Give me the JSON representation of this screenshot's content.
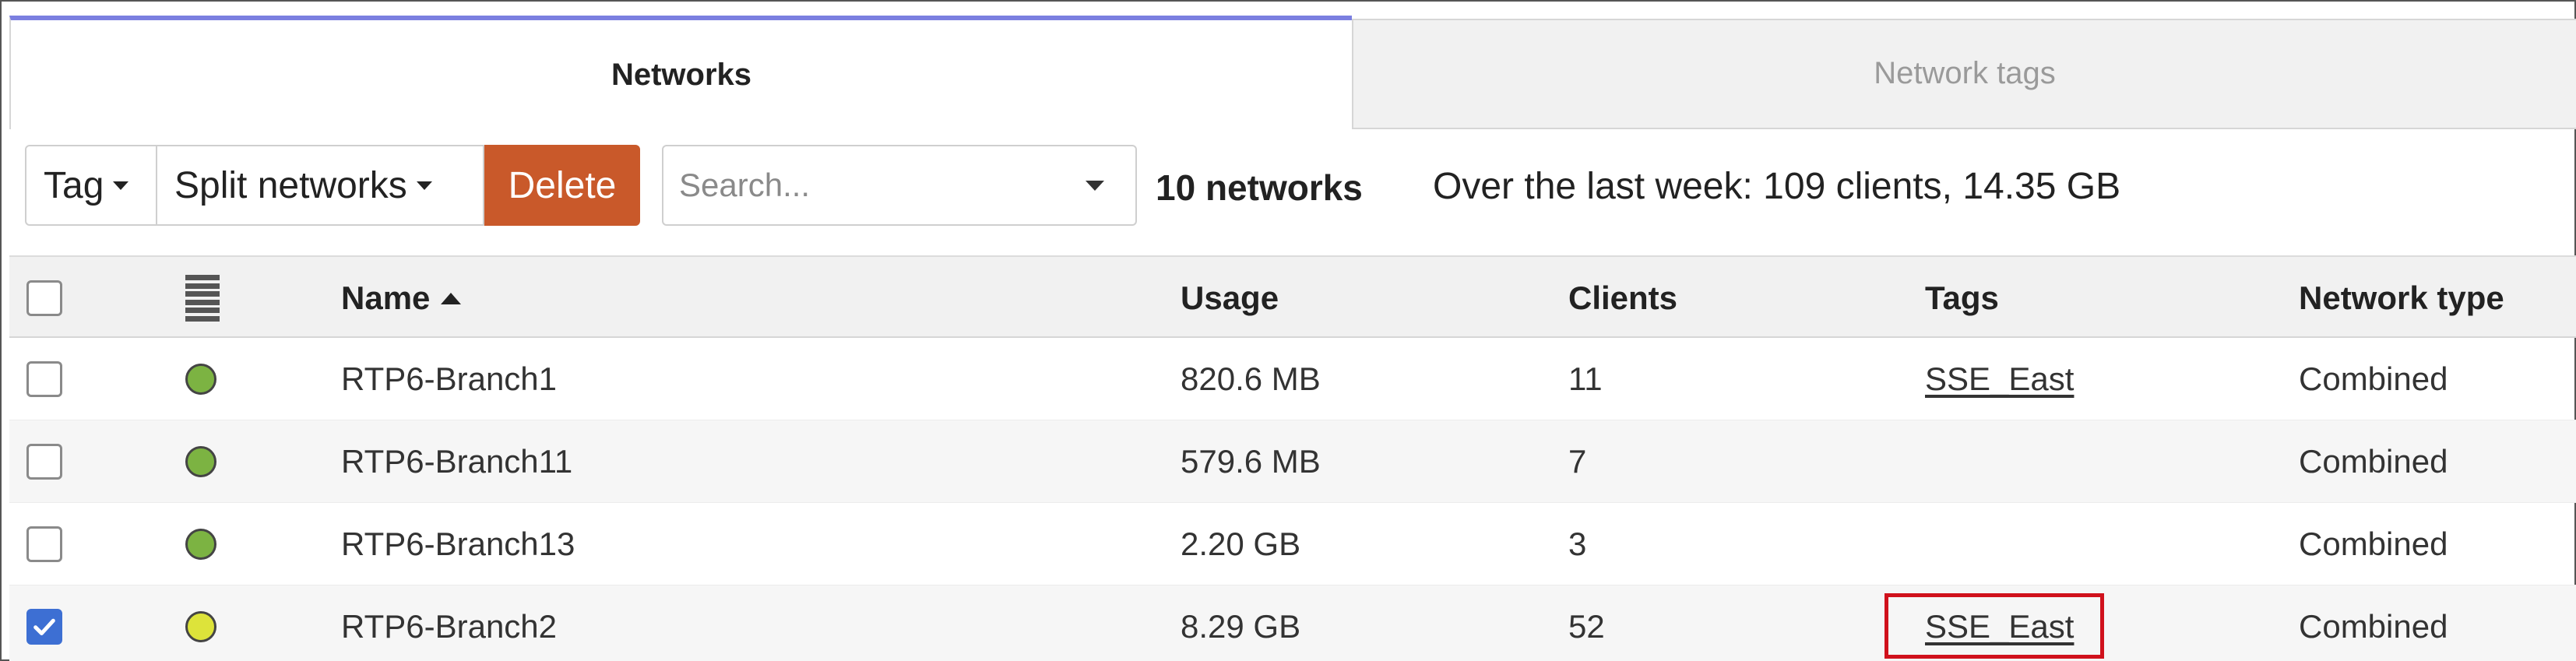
{
  "tabs": {
    "active_label": "Networks",
    "inactive_label": "Network tags"
  },
  "toolbar": {
    "tag_label": "Tag",
    "split_label": "Split networks",
    "delete_label": "Delete",
    "search_placeholder": "Search...",
    "network_count": "10 networks",
    "summary": "Over the last week: 109 clients, 14.35 GB"
  },
  "table": {
    "headers": {
      "name": "Name",
      "usage": "Usage",
      "clients": "Clients",
      "tags": "Tags",
      "type": "Network type"
    },
    "sort": "Name ascending",
    "rows": [
      {
        "name": "RTP6-Branch1",
        "usage": "820.6 MB",
        "clients": "11",
        "tag": "SSE_East",
        "type": "Combined",
        "status_color": "#7cb342",
        "checked": false
      },
      {
        "name": "RTP6-Branch11",
        "usage": "579.6 MB",
        "clients": "7",
        "tag": "",
        "type": "Combined",
        "status_color": "#7cb342",
        "checked": false
      },
      {
        "name": "RTP6-Branch13",
        "usage": "2.20 GB",
        "clients": "3",
        "tag": "",
        "type": "Combined",
        "status_color": "#7cb342",
        "checked": false
      },
      {
        "name": "RTP6-Branch2",
        "usage": "8.29 GB",
        "clients": "52",
        "tag": "SSE_East",
        "type": "Combined",
        "status_color": "#dde33a",
        "checked": true
      }
    ]
  },
  "colors": {
    "accent_tab": "#7b7fe0",
    "delete_button": "#c9592a",
    "highlight_box": "#d0111c",
    "checkbox_checked": "#3d6fd3"
  }
}
